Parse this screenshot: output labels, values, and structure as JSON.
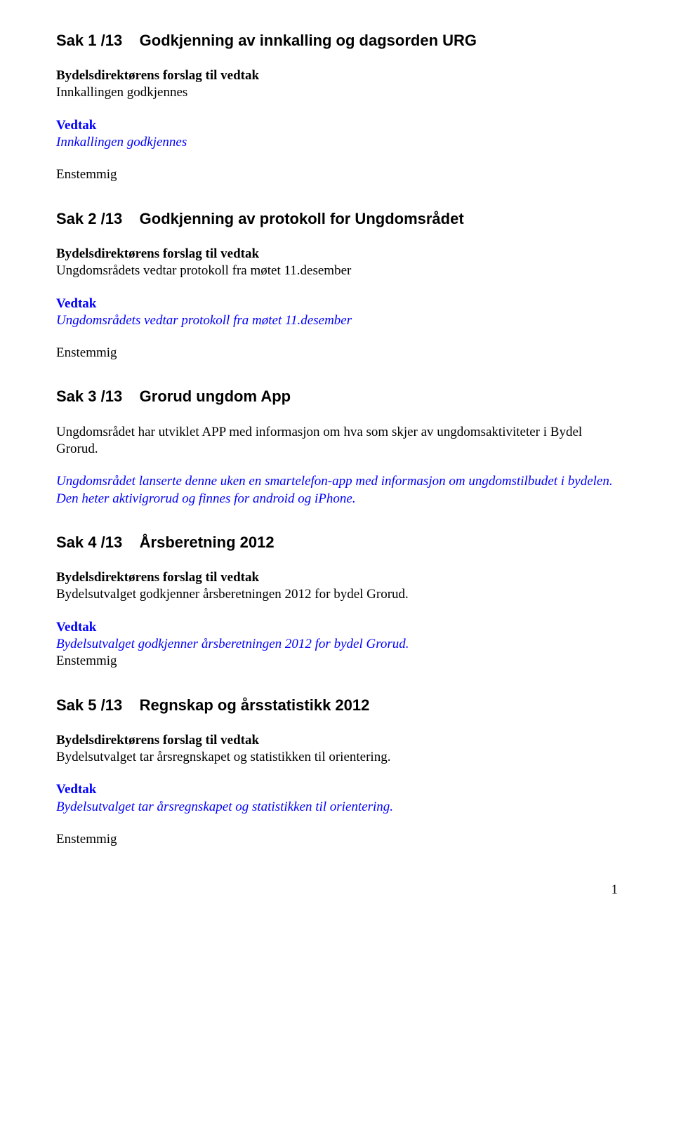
{
  "sak1": {
    "num": "Sak 1 /13",
    "title": "Godkjenning av innkalling og dagsorden URG",
    "forslag_label": "Bydelsdirektørens forslag til vedtak",
    "forslag_text": "Innkallingen godkjennes",
    "vedtak_label": "Vedtak",
    "vedtak_text": "Innkallingen godkjennes",
    "enstemmig": "Enstemmig"
  },
  "sak2": {
    "num": "Sak 2 /13",
    "title": "Godkjenning av protokoll for Ungdomsrådet",
    "forslag_label": "Bydelsdirektørens forslag til vedtak",
    "forslag_text": "Ungdomsrådets vedtar protokoll fra møtet 11.desember",
    "vedtak_label": "Vedtak",
    "vedtak_text": "Ungdomsrådets vedtar protokoll fra møtet 11.desember",
    "enstemmig": "Enstemmig"
  },
  "sak3": {
    "num": "Sak 3 /13",
    "title": "Grorud ungdom App",
    "body_text": "Ungdomsrådet har utviklet APP med informasjon om hva som skjer av ungdomsaktiviteter i Bydel Grorud.",
    "italic_text": "Ungdomsrådet lanserte denne uken en smartelefon-app med informasjon om ungdomstilbudet i bydelen. Den heter aktivigrorud og finnes for android og iPhone."
  },
  "sak4": {
    "num": "Sak 4 /13",
    "title": "Årsberetning 2012",
    "forslag_label": "Bydelsdirektørens forslag til vedtak",
    "forslag_text": "Bydelsutvalget godkjenner årsberetningen 2012 for bydel Grorud.",
    "vedtak_label": "Vedtak",
    "vedtak_text": "Bydelsutvalget godkjenner årsberetningen 2012 for bydel Grorud.",
    "enstemmig": "Enstemmig"
  },
  "sak5": {
    "num": "Sak 5 /13",
    "title": "Regnskap og årsstatistikk 2012",
    "forslag_label": "Bydelsdirektørens forslag til vedtak",
    "forslag_text": "Bydelsutvalget tar årsregnskapet og statistikken til orientering.",
    "vedtak_label": "Vedtak",
    "vedtak_text": "Bydelsutvalget tar årsregnskapet og statistikken til orientering.",
    "enstemmig": "Enstemmig"
  },
  "page_number": "1"
}
